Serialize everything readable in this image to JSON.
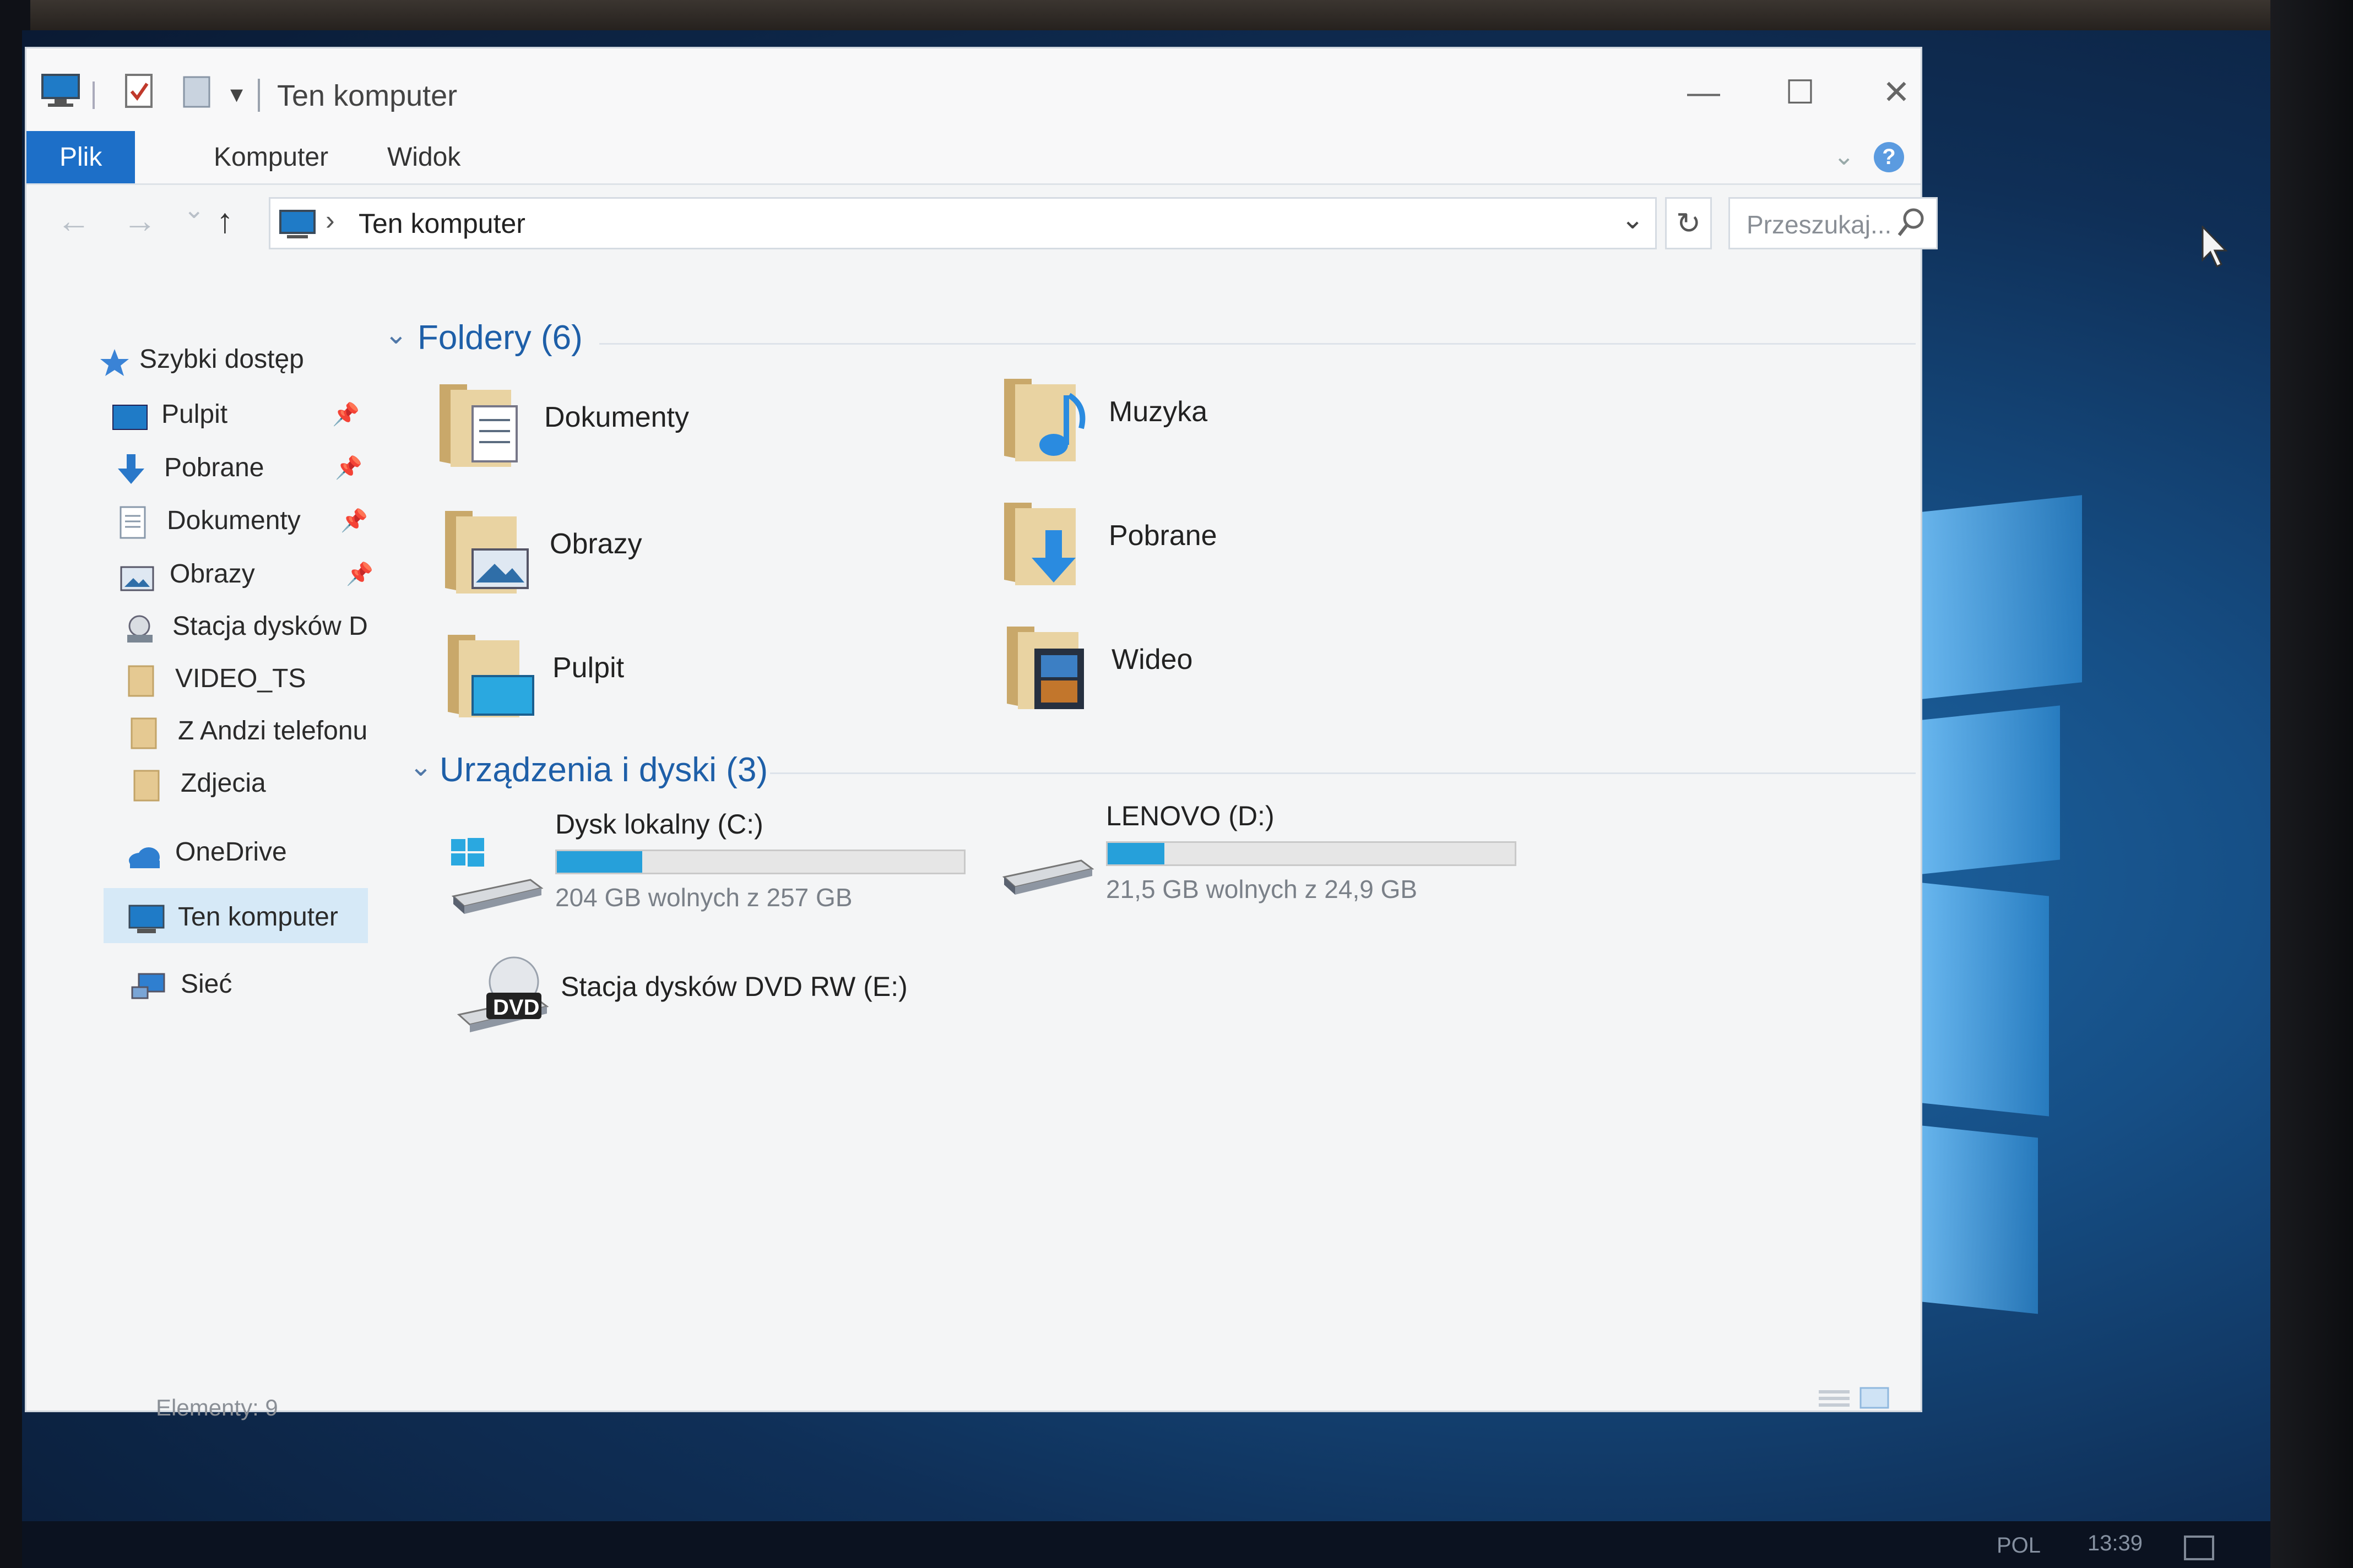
{
  "window": {
    "title": "Ten komputer",
    "controls": {
      "minimize": "—",
      "maximize": "☐",
      "close": "✕"
    }
  },
  "ribbon": {
    "tabs": [
      "Plik",
      "Komputer",
      "Widok"
    ],
    "help": "?"
  },
  "navigation": {
    "back": "←",
    "forward": "→",
    "recent": "⌄",
    "up": "↑",
    "address_chevron": "›",
    "address": "Ten komputer",
    "dropdown": "⌄",
    "refresh": "↻",
    "search_placeholder": "Przeszukaj..."
  },
  "sidebar": {
    "items": [
      {
        "label": "Szybki dostęp",
        "icon": "star-icon",
        "pinned": false
      },
      {
        "label": "Pulpit",
        "icon": "desktop-icon",
        "pinned": true
      },
      {
        "label": "Pobrane",
        "icon": "download-icon",
        "pinned": true
      },
      {
        "label": "Dokumenty",
        "icon": "document-icon",
        "pinned": true
      },
      {
        "label": "Obrazy",
        "icon": "pictures-icon",
        "pinned": true
      },
      {
        "label": "Stacja dysków D",
        "icon": "drive-icon",
        "pinned": false
      },
      {
        "label": "VIDEO_TS",
        "icon": "folder-icon",
        "pinned": false
      },
      {
        "label": "Z Andzi telefonu",
        "icon": "folder-icon",
        "pinned": false
      },
      {
        "label": "Zdjecia",
        "icon": "folder-icon",
        "pinned": false
      },
      {
        "label": "OneDrive",
        "icon": "onedrive-icon",
        "pinned": false
      },
      {
        "label": "Ten komputer",
        "icon": "computer-icon",
        "pinned": false
      },
      {
        "label": "Sieć",
        "icon": "network-icon",
        "pinned": false
      }
    ],
    "pin_glyph": "📌"
  },
  "content": {
    "folders_header": "Foldery (6)",
    "folders": [
      {
        "label": "Dokumenty",
        "icon": "documents-folder-icon"
      },
      {
        "label": "Muzyka",
        "icon": "music-folder-icon"
      },
      {
        "label": "Obrazy",
        "icon": "pictures-folder-icon"
      },
      {
        "label": "Pobrane",
        "icon": "downloads-folder-icon"
      },
      {
        "label": "Pulpit",
        "icon": "desktop-folder-icon"
      },
      {
        "label": "Wideo",
        "icon": "video-folder-icon"
      }
    ],
    "devices_header": "Urządzenia i dyski (3)",
    "drives": [
      {
        "label": "Dysk lokalny (C:)",
        "free": "204 GB wolnych z 257 GB",
        "used_fraction": 0.21
      },
      {
        "label": "LENOVO (D:)",
        "free": "21,5 GB wolnych z 24,9 GB",
        "used_fraction": 0.14
      },
      {
        "label": "Stacja dysków DVD RW (E:)",
        "badge": "DVD"
      }
    ]
  },
  "status": {
    "items": "Elementy: 9"
  },
  "taskbar": {
    "language": "POL",
    "time": "13:39"
  },
  "colors": {
    "accent": "#1d6fc8",
    "drive_bar": "#26a0da",
    "group_header": "#1e5fa8"
  }
}
